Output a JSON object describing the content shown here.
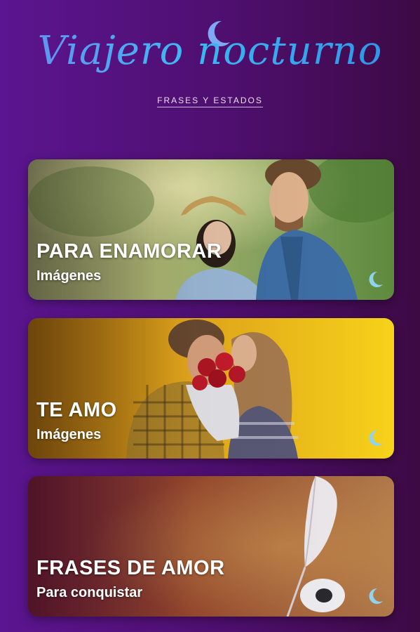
{
  "header": {
    "logo_text": "Viajero nocturno",
    "subtitle": "FRASES Y ESTADOS"
  },
  "cards": [
    {
      "title": "PARA ENAMORAR",
      "subtitle": "Imágenes"
    },
    {
      "title": "TE AMO",
      "subtitle": "Imágenes"
    },
    {
      "title": "FRASES DE AMOR",
      "subtitle": "Para conquistar"
    }
  ],
  "colors": {
    "background_start": "#5b1590",
    "background_end": "#3d0a44",
    "logo_blue": "#3db9f2",
    "moon_accent": "#8fd3ef"
  },
  "icons": [
    "crescent-moon-icon"
  ]
}
